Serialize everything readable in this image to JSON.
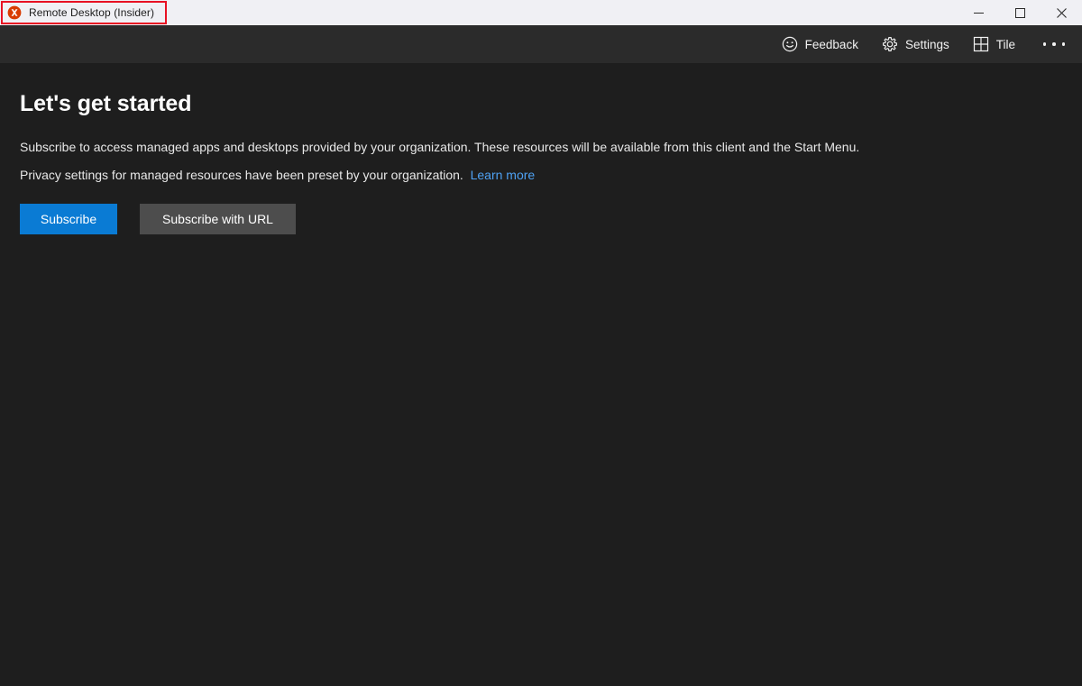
{
  "window": {
    "title": "Remote Desktop (Insider)",
    "app_icon": "remote-desktop-icon",
    "accent_blue": "#0a7bd4",
    "highlight_color": "#e81123",
    "titlebar_bg": "#f0f0f4",
    "toolbar_bg": "#2b2b2b",
    "content_bg": "#1e1e1e",
    "controls": {
      "minimize": "minimize-icon",
      "maximize": "maximize-icon",
      "close": "close-icon"
    }
  },
  "toolbar": {
    "items": [
      {
        "label": "Feedback",
        "icon": "smiley-face-icon"
      },
      {
        "label": "Settings",
        "icon": "gear-icon"
      },
      {
        "label": "Tile",
        "icon": "tile-grid-icon"
      }
    ],
    "overflow": "more-options-icon"
  },
  "main": {
    "heading": "Let's get started",
    "paragraph_1": "Subscribe to access managed apps and desktops provided by your organization. These resources will be available from this client and the Start Menu.",
    "paragraph_2_text": "Privacy settings for managed resources have been preset by your organization.",
    "paragraph_2_link": "Learn more",
    "buttons": {
      "primary": "Subscribe",
      "secondary": "Subscribe with URL"
    }
  }
}
